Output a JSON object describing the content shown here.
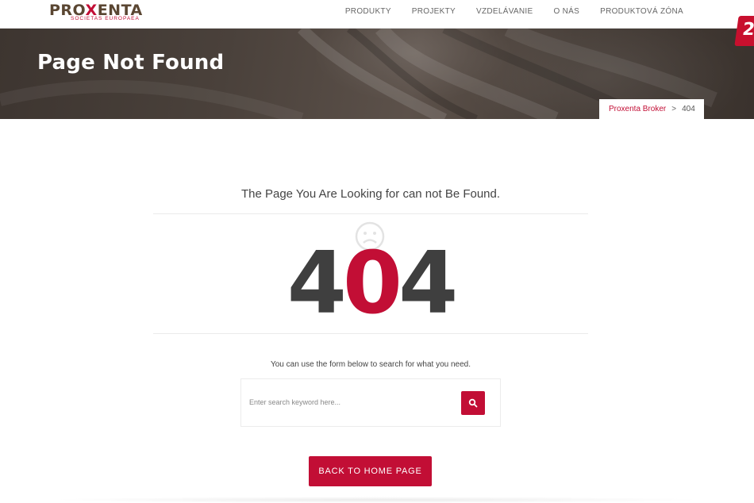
{
  "header": {
    "logo": {
      "name_prefix": "PRO",
      "name_x": "X",
      "name_suffix": "ENTA",
      "tagline": "SOCIETAS EUROPAEA"
    },
    "nav": [
      {
        "label": "PRODUKTY"
      },
      {
        "label": "PROJEKTY"
      },
      {
        "label": "VZDELÁVANIE"
      },
      {
        "label": "O NÁS"
      },
      {
        "label": "PRODUKTOVÁ ZÓNA"
      }
    ],
    "corner_badge": "2"
  },
  "hero": {
    "title": "Page Not Found",
    "breadcrumb": {
      "home": "Proxenta Broker",
      "separator": ">",
      "current": "404"
    }
  },
  "main": {
    "heading": "The Page You Are Looking for can not Be Found.",
    "code": {
      "d1": "4",
      "d2": "0",
      "d3": "4"
    },
    "helper_text": "You can use the form below to search for what you need.",
    "search": {
      "placeholder": "Enter search keyword here...",
      "value": "",
      "button_icon": "search-icon"
    },
    "home_button": "BACK TO HOME PAGE"
  },
  "colors": {
    "accent": "#c20e35",
    "dark_digit": "#3f3f3f",
    "logo_brown": "#5a4632"
  }
}
